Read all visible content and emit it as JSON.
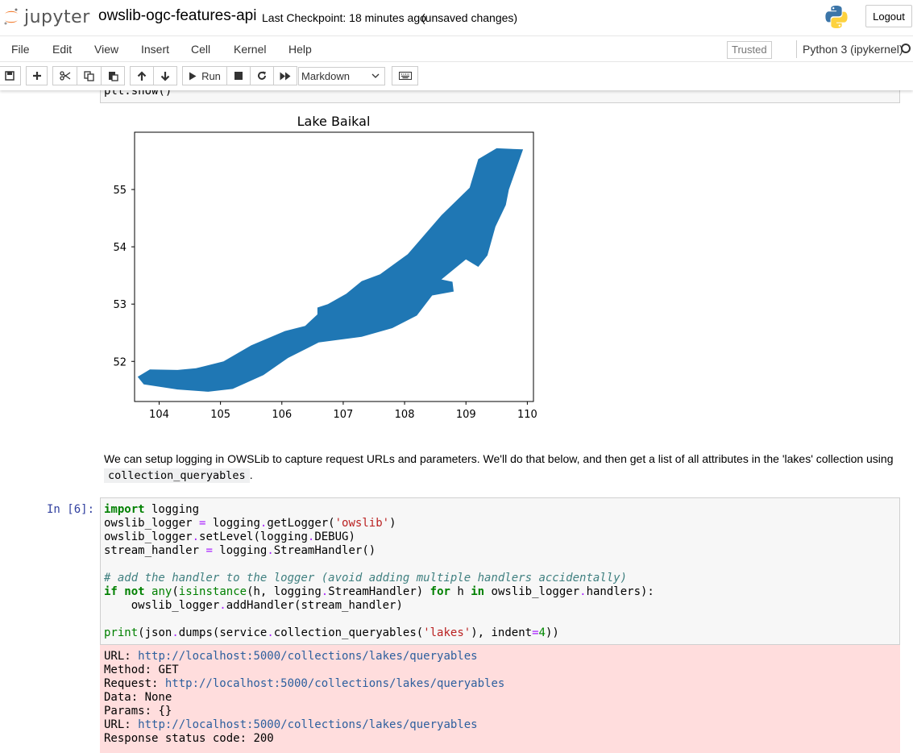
{
  "header": {
    "logo_text": "jupyter",
    "notebook_name": "owslib-ogc-features-api",
    "checkpoint": "Last Checkpoint: 18 minutes ago",
    "autosave": "(unsaved changes)",
    "logout_label": "Logout"
  },
  "menubar": {
    "items": [
      "File",
      "Edit",
      "View",
      "Insert",
      "Cell",
      "Kernel",
      "Help"
    ],
    "trusted": "Trusted",
    "kernel_name": "Python 3 (ipykernel)"
  },
  "toolbar": {
    "run_label": "Run",
    "cell_type": "Markdown",
    "icons": [
      "save-icon",
      "plus-icon",
      "scissors-icon",
      "copy-icon",
      "paste-icon",
      "arrow-up-icon",
      "arrow-down-icon",
      "play-icon",
      "stop-icon",
      "restart-icon",
      "fast-forward-icon",
      "keyboard-icon"
    ]
  },
  "prev_cell": {
    "code_tail": "plt.show()"
  },
  "chart_data": {
    "type": "area",
    "title": "Lake Baikal",
    "xlabel": "",
    "ylabel": "",
    "xlim": [
      103.6,
      110.1
    ],
    "ylim": [
      51.3,
      56.0
    ],
    "xticks": [
      "104",
      "105",
      "106",
      "107",
      "108",
      "109",
      "110"
    ],
    "yticks": [
      "52",
      "53",
      "54",
      "55"
    ],
    "fill_color": "#1f77b4",
    "polygon": [
      [
        103.65,
        51.73
      ],
      [
        103.75,
        51.6
      ],
      [
        104.3,
        51.51
      ],
      [
        104.8,
        51.47
      ],
      [
        105.2,
        51.52
      ],
      [
        105.7,
        51.76
      ],
      [
        106.1,
        52.06
      ],
      [
        106.6,
        52.33
      ],
      [
        107.3,
        52.43
      ],
      [
        107.8,
        52.58
      ],
      [
        108.2,
        52.8
      ],
      [
        108.45,
        53.15
      ],
      [
        108.8,
        53.22
      ],
      [
        108.78,
        53.39
      ],
      [
        108.6,
        53.43
      ],
      [
        109.0,
        53.78
      ],
      [
        109.2,
        53.65
      ],
      [
        109.35,
        53.85
      ],
      [
        109.48,
        54.35
      ],
      [
        109.65,
        54.73
      ],
      [
        109.7,
        55.0
      ],
      [
        109.93,
        55.7
      ],
      [
        109.5,
        55.72
      ],
      [
        109.2,
        55.53
      ],
      [
        109.06,
        55.03
      ],
      [
        108.6,
        54.55
      ],
      [
        108.05,
        53.87
      ],
      [
        107.6,
        53.52
      ],
      [
        107.3,
        53.4
      ],
      [
        107.05,
        53.18
      ],
      [
        106.75,
        53.0
      ],
      [
        106.58,
        52.94
      ],
      [
        106.58,
        52.82
      ],
      [
        106.38,
        52.62
      ],
      [
        106.05,
        52.53
      ],
      [
        105.5,
        52.28
      ],
      [
        105.05,
        52.0
      ],
      [
        104.6,
        51.88
      ],
      [
        104.3,
        51.85
      ],
      [
        103.85,
        51.86
      ]
    ]
  },
  "markdown": {
    "text": "We can setup logging in OWSLib to capture request URLs and parameters. We'll do that below, and then get a list of all attributes in the 'lakes' collection using",
    "code": "collection_queryables",
    "end": "."
  },
  "code_cell": {
    "prompt": "In [6]:"
  },
  "stderr": {
    "lines": [
      {
        "label": "URL: ",
        "value": "http://localhost:5000/collections/lakes/queryables",
        "is_url": true
      },
      {
        "label": "Method: ",
        "value": "GET",
        "is_url": false
      },
      {
        "label": "Request: ",
        "value": "http://localhost:5000/collections/lakes/queryables",
        "is_url": true
      },
      {
        "label": "Data: ",
        "value": "None",
        "is_url": false
      },
      {
        "label": "Params: ",
        "value": "{}",
        "is_url": false
      },
      {
        "label": "URL: ",
        "value": "http://localhost:5000/collections/lakes/queryables",
        "is_url": true
      },
      {
        "label": "Response status code: ",
        "value": "200",
        "is_url": false
      }
    ]
  }
}
